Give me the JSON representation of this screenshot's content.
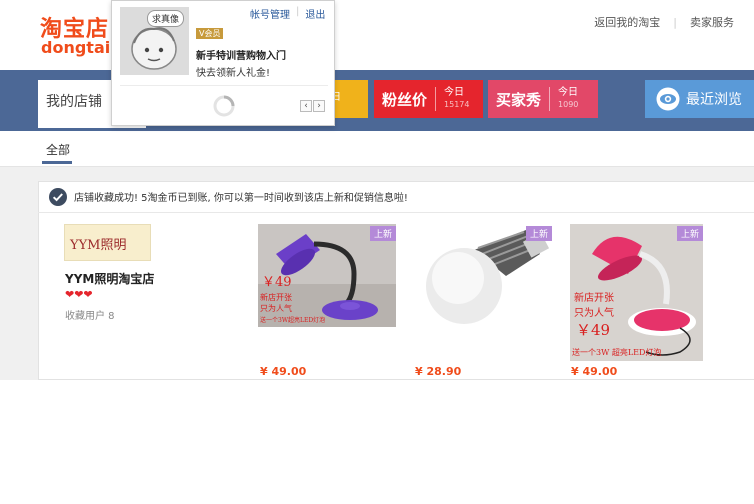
{
  "header": {
    "logo_cn": "淘宝店",
    "logo_en": "dongtai",
    "links": [
      "返回我的淘宝",
      "卖家服务"
    ]
  },
  "nav": {
    "my_shop": "我的店铺",
    "yellow_tab": "日",
    "fans_price": {
      "label": "粉丝价",
      "today": "今日",
      "count": "15174"
    },
    "buyer_show": {
      "label": "买家秀",
      "today": "今日",
      "count": "1090"
    },
    "recent": "最近浏览"
  },
  "tabs": {
    "all": "全部"
  },
  "notice": "店铺收藏成功! 5淘金币已到账, 你可以第一时间收到该店上新和促销信息啦!",
  "shop": {
    "logo_text": "YYM照明",
    "name": "YYM照明淘宝店",
    "hearts": "❤❤❤",
    "fav_users": "收藏用户 8"
  },
  "products": [
    {
      "badge": "上新",
      "price": "¥ 49.00",
      "img_text": [
        "￥49",
        "新店开张",
        "只为人气",
        "送一个3W超亮LED灯泡"
      ]
    },
    {
      "badge": "上新",
      "price": "¥ 28.90",
      "img_text": []
    },
    {
      "badge": "上新",
      "price": "¥ 49.00",
      "img_text": [
        "新店开张",
        "只为人气",
        "￥49",
        "送一个3W 超亮LED灯泡"
      ]
    }
  ],
  "popup": {
    "bubble": "求真像",
    "links": [
      "帐号管理",
      "退出"
    ],
    "badge": "V会员",
    "title": "新手特训营购物入门",
    "subtitle": "快去领新人礼金!",
    "prev": "‹",
    "next": "›"
  },
  "colors": {
    "brand": "#f04c1b",
    "nav_band": "#4c6896",
    "fans": "#e5252d",
    "show": "#e24868",
    "recent": "#5a9ad8"
  }
}
